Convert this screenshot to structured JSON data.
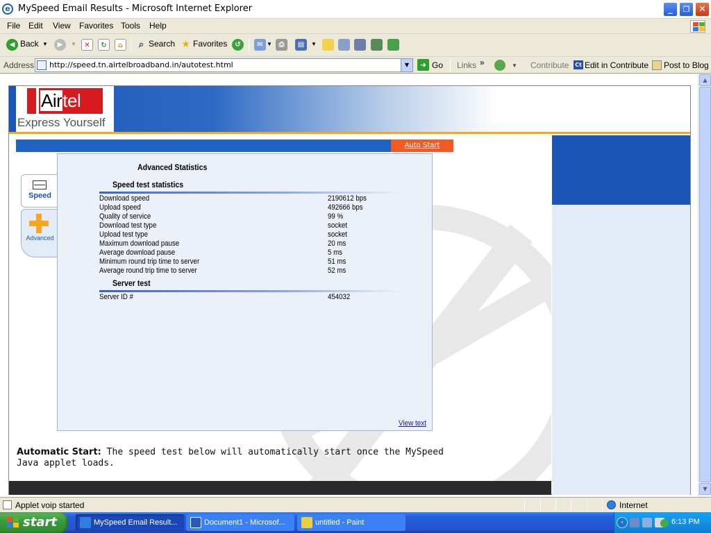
{
  "window": {
    "title": "MySpeed Email Results - Microsoft Internet Explorer",
    "min_glyph": "_",
    "max_glyph": "❐",
    "close_glyph": "✕",
    "icon_glyph": "e"
  },
  "menu": [
    "File",
    "Edit",
    "View",
    "Favorites",
    "Tools",
    "Help"
  ],
  "toolbar": {
    "back": "Back",
    "search": "Search",
    "favorites": "Favorites"
  },
  "address": {
    "label": "Address",
    "url": "http://speed.tn.airtelbroadband.in/autotest.html",
    "go": "Go",
    "links": "Links",
    "contribute": "Contribute",
    "edit_in_contribute": "Edit in Contribute",
    "post_to_blog": "Post to Blog"
  },
  "page": {
    "logo_text_left": "Air",
    "logo_text_right": "tel",
    "tagline": "Express Yourself",
    "auto_start": "Auto Start",
    "tab_speed": "Speed",
    "tab_advanced": "Advanced",
    "stats_title": "Advanced Statistics",
    "section_speed": "Speed test statistics",
    "stats": [
      {
        "label": "Download speed",
        "value": "2190612 bps"
      },
      {
        "label": "Upload speed",
        "value": "492666 bps"
      },
      {
        "label": "Quality of service",
        "value": "99 %"
      },
      {
        "label": "Download test type",
        "value": "socket"
      },
      {
        "label": "Upload test type",
        "value": "socket"
      },
      {
        "label": "Maximum download pause",
        "value": "20 ms"
      },
      {
        "label": "Average download pause",
        "value": "5 ms"
      },
      {
        "label": "Minimum round trip time to server",
        "value": "51 ms"
      },
      {
        "label": "Average round trip time to server",
        "value": "52 ms"
      }
    ],
    "section_server": "Server test",
    "server": [
      {
        "label": "Server ID #",
        "value": "454032"
      }
    ],
    "view_text": "View text",
    "auto_note_bold": "Automatic Start:",
    "auto_note_text": " The speed test below will automatically start once the MySpeed Java applet loads."
  },
  "status": {
    "text": "Applet voip started",
    "zone": "Internet"
  },
  "taskbar": {
    "start": "start",
    "tasks": [
      "MySpeed Email Result...",
      "Document1 - Microsof...",
      "untitled - Paint"
    ],
    "clock": "6:13 PM"
  },
  "colors": {
    "airtel_red": "#d71a1f",
    "brand_blue": "#1a56b8",
    "auto_start_orange": "#f15a22"
  }
}
